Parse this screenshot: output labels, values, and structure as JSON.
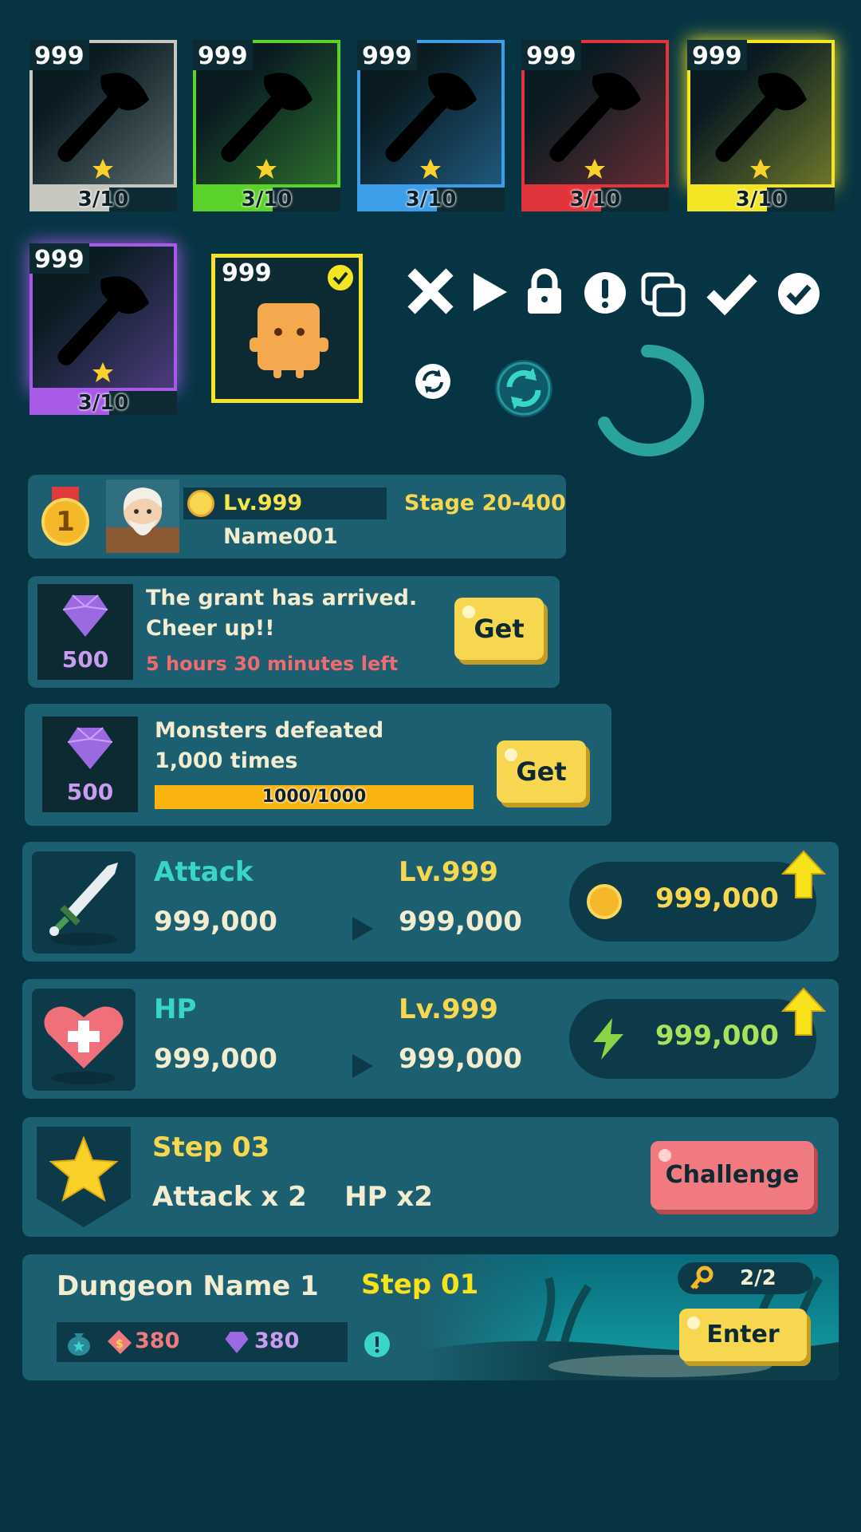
{
  "item_cards": [
    {
      "count": "999",
      "level": "3/10",
      "color": "#c7c7c0"
    },
    {
      "count": "999",
      "level": "3/10",
      "color": "#5bd22a"
    },
    {
      "count": "999",
      "level": "3/10",
      "color": "#3c9de8"
    },
    {
      "count": "999",
      "level": "3/10",
      "color": "#e2353b"
    },
    {
      "count": "999",
      "level": "3/10",
      "color": "#f4e524"
    },
    {
      "count": "999",
      "level": "3/10",
      "color": "#a65ae6"
    }
  ],
  "character_card": {
    "count": "999"
  },
  "icons": [
    "close-icon",
    "play-icon",
    "lock-icon",
    "alert-icon",
    "copy-icon",
    "check-icon",
    "check-circle-icon",
    "refresh-icon",
    "refresh-active-icon",
    "loading-spinner-icon"
  ],
  "player": {
    "rank": "1",
    "level": "Lv.999",
    "stage": "Stage 20-400",
    "name": "Name001"
  },
  "grant": {
    "gem_amount": "500",
    "line1": "The grant has arrived.",
    "line2": "Cheer up!!",
    "time_left": "5 hours 30 minutes left",
    "button": "Get"
  },
  "mission": {
    "gem_amount": "500",
    "line1": "Monsters defeated",
    "line2": "1,000 times",
    "progress_text": "1000/1000",
    "progress": 1.0,
    "button": "Get"
  },
  "attack": {
    "label": "Attack",
    "level": "Lv.999",
    "current": "999,000",
    "next": "999,000",
    "cost": "999,000"
  },
  "hp": {
    "label": "HP",
    "level": "Lv.999",
    "current": "999,000",
    "next": "999,000",
    "cost": "999,000"
  },
  "step": {
    "title": "Step 03",
    "bonus": "Attack x 2    HP x2",
    "button": "Challenge"
  },
  "dungeon": {
    "name": "Dungeon Name 1",
    "step": "Step 01",
    "reward1": "380",
    "reward2": "380",
    "keys": "2/2",
    "button": "Enter"
  },
  "colors": {
    "background": "#063443",
    "panel": "#1c5f70",
    "accent_yellow": "#f8d750",
    "accent_teal": "#39d6c7",
    "challenge": "#f07a7f"
  }
}
